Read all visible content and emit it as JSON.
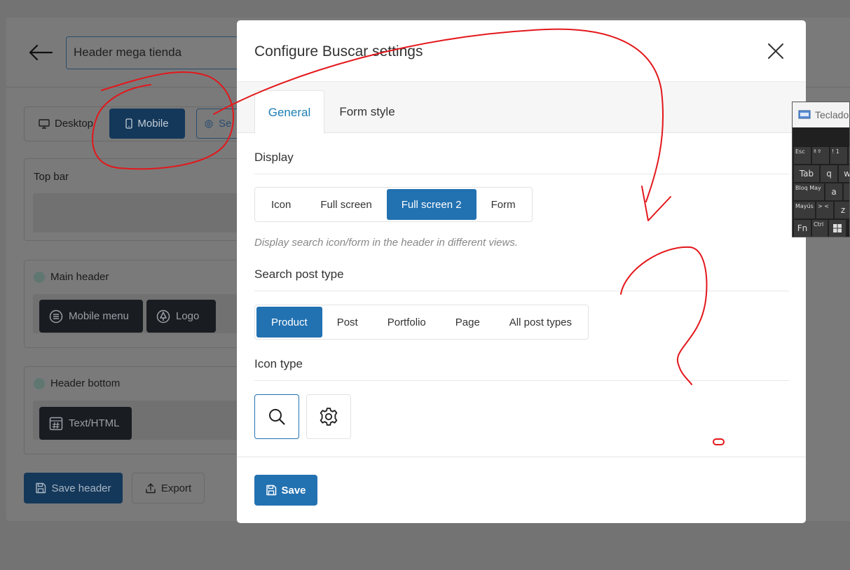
{
  "background": {
    "header_title_value": "Header mega tienda",
    "devices": {
      "desktop": "Desktop",
      "mobile": "Mobile",
      "settings": "Se"
    },
    "sections": {
      "top_bar": "Top bar",
      "main_header": "Main header",
      "header_bottom": "Header bottom"
    },
    "chips": {
      "mobile_menu": "Mobile menu",
      "logo": "Logo",
      "text_html": "Text/HTML"
    },
    "save_header": "Save header",
    "export": "Export"
  },
  "modal": {
    "title": "Configure Buscar settings",
    "tabs": [
      {
        "label": "General",
        "active": true
      },
      {
        "label": "Form style",
        "active": false
      }
    ],
    "display": {
      "label": "Display",
      "options": [
        "Icon",
        "Full screen",
        "Full screen 2",
        "Form"
      ],
      "selected": "Full screen 2",
      "help": "Display search icon/form in the header in different views."
    },
    "post_type": {
      "label": "Search post type",
      "options": [
        "Product",
        "Post",
        "Portfolio",
        "Page",
        "All post types"
      ],
      "selected": "Product"
    },
    "icon_type": {
      "label": "Icon type",
      "options": [
        "search-icon",
        "gear-icon"
      ],
      "selected": "search-icon"
    },
    "save": "Save"
  },
  "keyboard": {
    "title": "Teclado",
    "keys": {
      "esc": "Esc",
      "degree": "ª º",
      "one": "! 1",
      "tab": "Tab",
      "q": "q",
      "w": "w",
      "caps": "Bloq May",
      "a": "a",
      "s": "s",
      "shift": "Mayús",
      "lt": "> <",
      "z": "z",
      "fn": "Fn",
      "ctrl": "Ctrl"
    }
  },
  "colors": {
    "accent": "#2271b1",
    "tab_active": "#1c7eb5",
    "annotation": "#e3171b",
    "overlay": "#737373"
  }
}
